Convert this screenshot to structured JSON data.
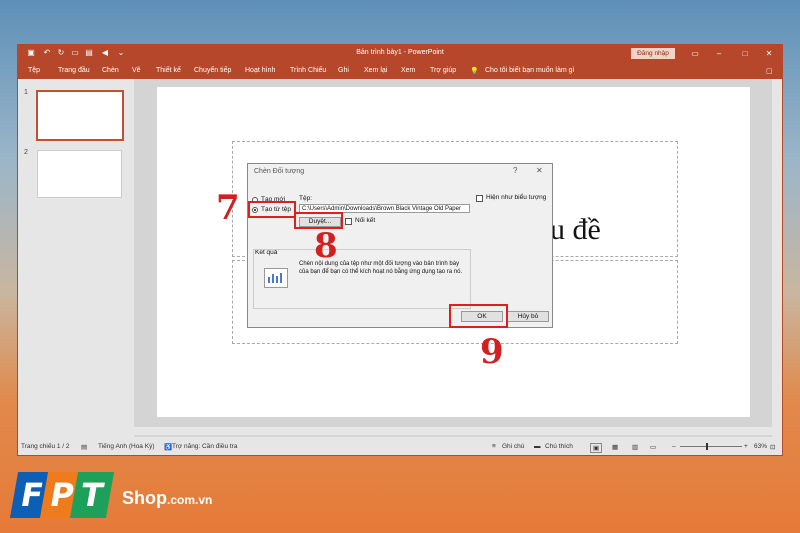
{
  "window": {
    "title": "Bản trình bày1 - PowerPoint",
    "sign_in": "Đăng nhập",
    "quick_access": [
      "save-icon",
      "undo-icon",
      "redo-icon",
      "present-icon",
      "format-icon",
      "speaker-icon",
      "dropdown-icon"
    ],
    "controls": [
      "restore-ribbon-icon",
      "minimize-icon",
      "maximize-icon",
      "close-icon"
    ]
  },
  "ribbon": {
    "tabs": [
      "Tệp",
      "Trang đầu",
      "Chèn",
      "Vẽ",
      "Thiết kế",
      "Chuyển tiếp",
      "Hoạt hình",
      "Trình Chiếu",
      "Ghi",
      "Xem lại",
      "Xem",
      "Trợ giúp"
    ],
    "tell_me": "Cho tôi biết bạn muốn làm gì"
  },
  "thumbnails": [
    {
      "num": "1"
    },
    {
      "num": "2"
    }
  ],
  "slide": {
    "title_fragment": "u đề"
  },
  "dialog": {
    "title": "Chèn Đối tượng",
    "help": "?",
    "close": "✕",
    "opt_new": "Tạo mới",
    "opt_file": "Tạo từ tệp",
    "file_label": "Tệp:",
    "file_path": "C:\\Users\\Admin\\Downloads\\Brown Black Vintage Old Paper",
    "browse": "Duyệt...",
    "link": "Nối kết",
    "show_icon": "Hiện như biểu tượng",
    "result_label": "Kết quả",
    "result_text": "Chèn nội dung của tệp như một đối tượng vào bản trình bày của bạn để bạn có thể kích hoạt nó bằng ứng dụng tạo ra nó.",
    "ok": "OK",
    "cancel": "Hủy bỏ"
  },
  "status": {
    "slide_info": "Trang chiếu 1 / 2",
    "language": "Tiếng Anh (Hoa Kỳ)",
    "accessibility": "Trợ năng: Cần điều tra",
    "notes": "Ghi chú",
    "comments": "Chú thích",
    "zoom": "63%"
  },
  "annotations": [
    "7",
    "8",
    "9"
  ],
  "brand": {
    "letters": [
      "F",
      "P",
      "T"
    ],
    "name": "Shop",
    "domain": ".com.vn"
  },
  "colors": {
    "accent": "#b7472a",
    "annotation": "#d21f1f"
  }
}
